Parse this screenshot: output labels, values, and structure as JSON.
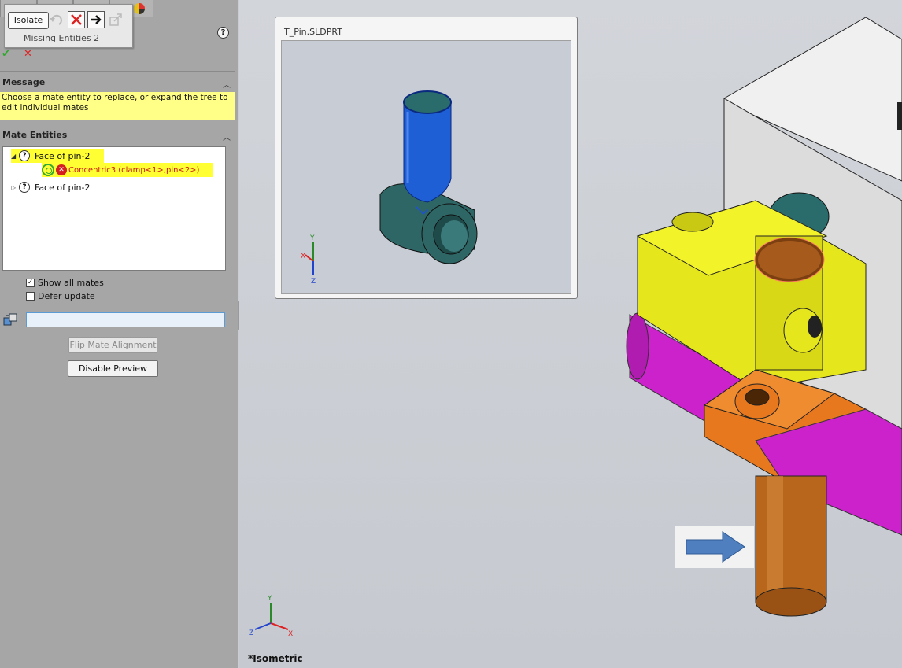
{
  "toolbar": {
    "isolate_label": "Isolate",
    "missing_entities": "Missing Entities 2"
  },
  "panel": {
    "message_title": "Message",
    "message_text": "Choose a mate entity to replace, or expand the tree to edit individual mates",
    "mate_entities_title": "Mate Entities",
    "tree": [
      {
        "label": "Face of pin-2",
        "expanded": true,
        "highlighted": true
      },
      {
        "label": "Concentric3 (clamp<1>,pin<2>)",
        "child": true,
        "error": true,
        "highlighted": true
      },
      {
        "label": "Face of pin-2",
        "expanded": false,
        "highlighted": false
      }
    ],
    "show_all_mates": "Show all mates",
    "show_all_mates_checked": true,
    "defer_update": "Defer update",
    "defer_update_checked": false,
    "entity_field_value": "",
    "flip_mate_alignment": "Flip Mate Alignment",
    "disable_preview": "Disable Preview"
  },
  "preview": {
    "title": "T_Pin.SLDPRT"
  },
  "viewport": {
    "view_name": "*Isometric"
  },
  "colors": {
    "highlight": "#ffff33",
    "message_bg": "#ffff88",
    "error": "#cc1a1a",
    "selected_face": "#1f5fd6",
    "clamp_yellow": "#e6e61c",
    "pipe_magenta": "#cc22cc",
    "bracket_orange": "#e8781e",
    "pin_brown": "#b8661c",
    "teal": "#2a6b6b"
  }
}
